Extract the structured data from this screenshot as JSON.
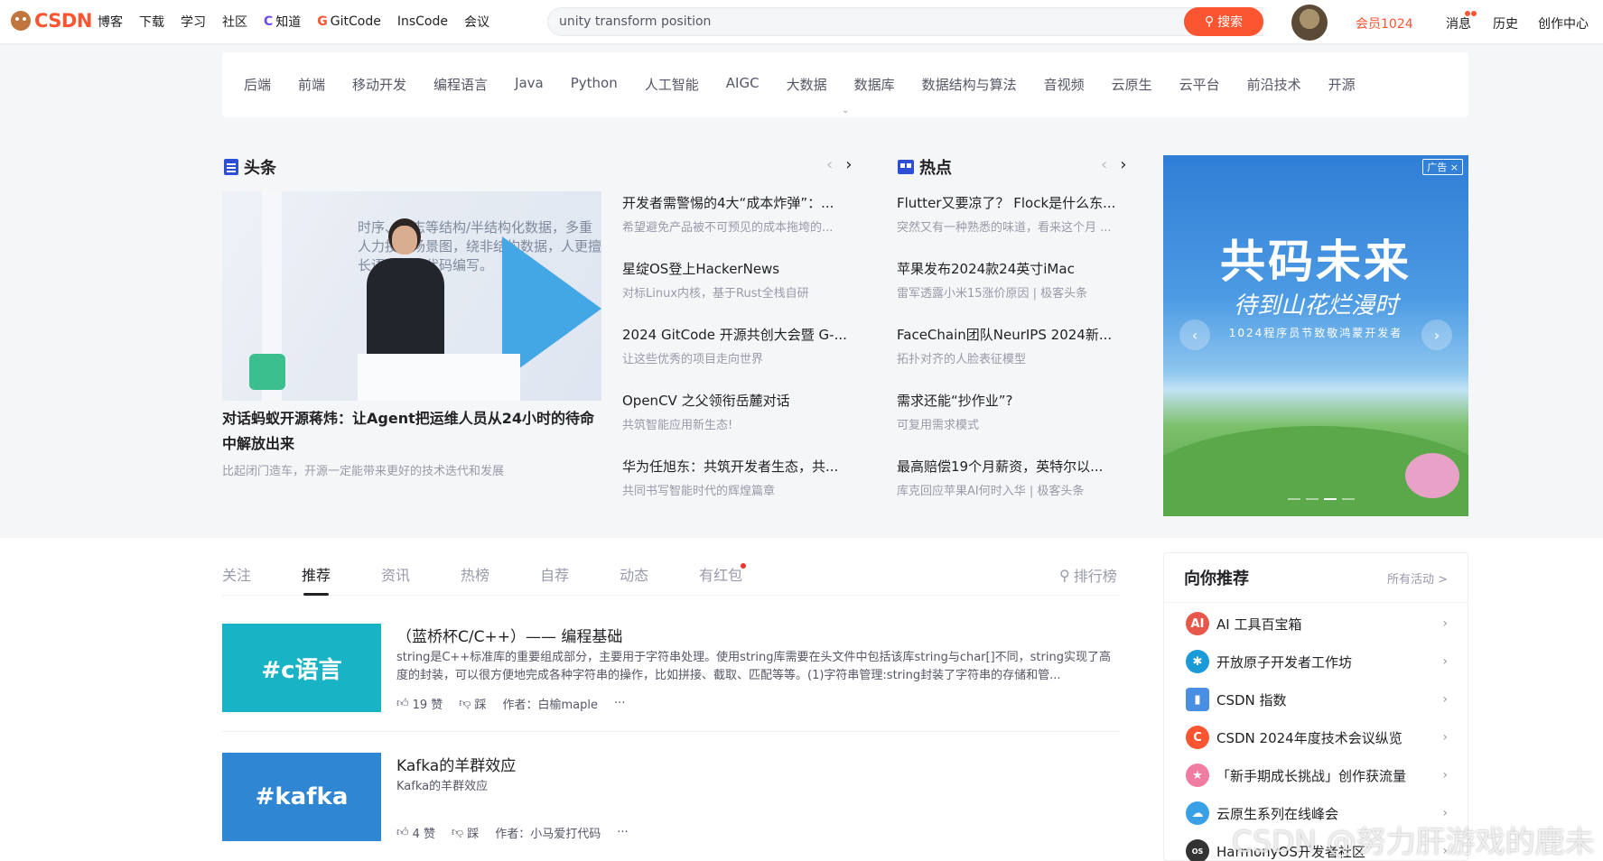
{
  "topbar": {
    "logo": "CSDN",
    "nav": [
      "博客",
      "下载",
      "学习",
      "社区",
      "知道",
      "GitCode",
      "InsCode",
      "会议"
    ],
    "search_value": "unity transform position",
    "search_button": "搜索",
    "vip_label": "会员1024",
    "right_nav": [
      "消息",
      "历史",
      "创作中心"
    ]
  },
  "categories": [
    "后端",
    "前端",
    "移动开发",
    "编程语言",
    "Java",
    "Python",
    "人工智能",
    "AIGC",
    "大数据",
    "数据库",
    "数据结构与算法",
    "音视频",
    "云原生",
    "云平台",
    "前沿技术",
    "开源"
  ],
  "headlines": {
    "title": "头条",
    "hero": {
      "image_text": "时序、日志等结构/半结构化数据，多重人力投入场景图，绕非结构数据，人更擅长语言交，代码编写。",
      "title": "对话蚂蚁开源蒋炜：让Agent把运维人员从24小时的待命中解放出来",
      "subtitle": "比起闭门造车，开源一定能带来更好的技术迭代和发展"
    },
    "items": [
      {
        "title": "开发者需警惕的4大“成本炸弹”：...",
        "sub": "希望避免产品被不可预见的成本拖垮的..."
      },
      {
        "title": "星绽OS登上HackerNews",
        "sub": "对标Linux内核，基于Rust全栈自研"
      },
      {
        "title": "2024 GitCode 开源共创大会暨 G-...",
        "sub": "让这些优秀的项目走向世界"
      },
      {
        "title": "OpenCV 之父领衔岳麓对话",
        "sub": "共筑智能应用新生态!"
      },
      {
        "title": "华为任旭东：共筑开发者生态，共...",
        "sub": "共同书写智能时代的辉煌篇章"
      }
    ]
  },
  "hot": {
    "title": "热点",
    "items": [
      {
        "title": "Flutter又要凉了？ Flock是什么东...",
        "sub": "突然又有一种熟悉的味道，看来这个月 ..."
      },
      {
        "title": "苹果发布2024款24英寸iMac",
        "sub": "雷军透露小米15涨价原因 | 极客头条"
      },
      {
        "title": "FaceChain团队NeurIPS 2024新...",
        "sub": "拓扑对齐的人脸表征模型"
      },
      {
        "title": "需求还能“抄作业”?",
        "sub": "可复用需求模式"
      },
      {
        "title": "最高赔偿19个月薪资，英特尔以...",
        "sub": "库克回应苹果AI何时入华 | 极客头条"
      }
    ]
  },
  "ad": {
    "tag": "广告",
    "headline": "共码未来",
    "script": "待到山花烂漫时",
    "small": "1024程序员节致敬鸿蒙开发者"
  },
  "feed": {
    "tabs": [
      "关注",
      "推荐",
      "资讯",
      "热榜",
      "自荐",
      "动态",
      "有红包"
    ],
    "active_tab": "推荐",
    "rank_label": "排行榜",
    "cards": [
      {
        "thumb_text": "#c语言",
        "title": "（蓝桥杯C/C++）—— 编程基础",
        "desc": "string是C++标准库的重要组成部分，主要用于字符串处理。使用string库需要在头文件中包括该库string与char[]不同，string实现了高度的封装，可以很方便地完成各种字符串的操作，比如拼接、截取、匹配等等。(1)字符串管理:string封装了字符串的存储和管...",
        "likes": "19 赞",
        "dislike": "踩",
        "author": "作者：白榆maple",
        "more": "···",
        "thumb_color": "#18b3c4"
      },
      {
        "thumb_text": "#kafka",
        "title": "Kafka的羊群效应",
        "desc": "Kafka的羊群效应",
        "likes": "4 赞",
        "dislike": "踩",
        "author": "作者：小马爱打代码",
        "more": "···",
        "thumb_color": "#2f86d3"
      }
    ]
  },
  "recommend": {
    "title": "向你推荐",
    "all": "所有活动 >",
    "items": [
      {
        "label": "AI 工具百宝箱",
        "color": "#e8584a"
      },
      {
        "label": "开放原子开发者工作坊",
        "color": "#1a9bd7"
      },
      {
        "label": "CSDN 指数",
        "color": "#4b8fe2"
      },
      {
        "label": "CSDN 2024年度技术会议纵览",
        "color": "#fc5531"
      },
      {
        "label": "「新手期成长挑战」创作获流量",
        "color": "#f07ca2"
      },
      {
        "label": "云原生系列在线峰会",
        "color": "#3aa0e6"
      },
      {
        "label": "HarmonyOS开发者社区",
        "color": "#333333"
      }
    ]
  },
  "watermark": "CSDN @努力肝游戏的鹿未"
}
